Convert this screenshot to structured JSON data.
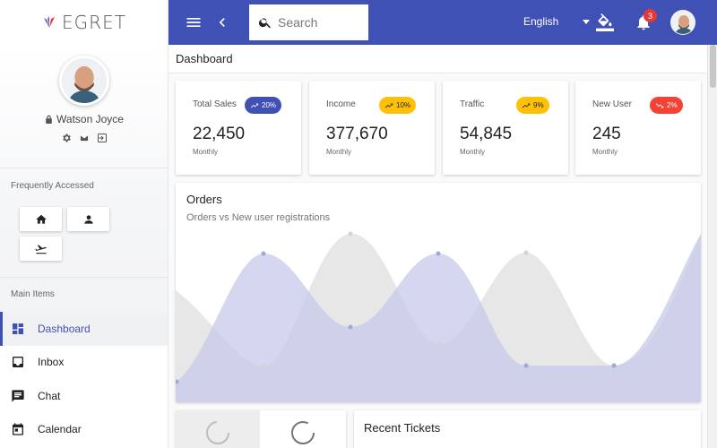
{
  "app": {
    "brand": "EGRET"
  },
  "colors": {
    "primary": "#3f51b5",
    "warn": "#ffc107",
    "danger": "#f44336"
  },
  "user": {
    "name": "Watson Joyce"
  },
  "sidebar": {
    "frequent_title": "Frequently Accessed",
    "frequent_items": [
      "home-icon",
      "person-icon",
      "flight-icon"
    ],
    "main_title": "Main Items",
    "items": [
      {
        "label": "Dashboard",
        "icon": "dashboard-icon",
        "active": true
      },
      {
        "label": "Inbox",
        "icon": "inbox-icon"
      },
      {
        "label": "Chat",
        "icon": "chat-icon"
      },
      {
        "label": "Calendar",
        "icon": "calendar-icon"
      }
    ]
  },
  "topbar": {
    "search_placeholder": "Search",
    "language": "English",
    "notifications": "3"
  },
  "breadcrumb": "Dashboard",
  "stats": [
    {
      "title": "Total Sales",
      "value": "22,450",
      "sub": "Monthly",
      "change": "20%",
      "trend": "up",
      "color": "#3f51b5",
      "text_color": "#ffffff"
    },
    {
      "title": "Income",
      "value": "377,670",
      "sub": "Monthly",
      "change": "10%",
      "trend": "up",
      "color": "#ffc107",
      "text_color": "#222222"
    },
    {
      "title": "Traffic",
      "value": "54,845",
      "sub": "Monthly",
      "change": "9%",
      "trend": "up",
      "color": "#ffc107",
      "text_color": "#222222"
    },
    {
      "title": "New User",
      "value": "245",
      "sub": "Monthly",
      "change": "2%",
      "trend": "down",
      "color": "#f44336",
      "text_color": "#ffffff"
    }
  ],
  "orders": {
    "title": "Orders",
    "subtitle": "Orders vs New user registrations"
  },
  "tickets": {
    "title": "Recent Tickets"
  }
}
